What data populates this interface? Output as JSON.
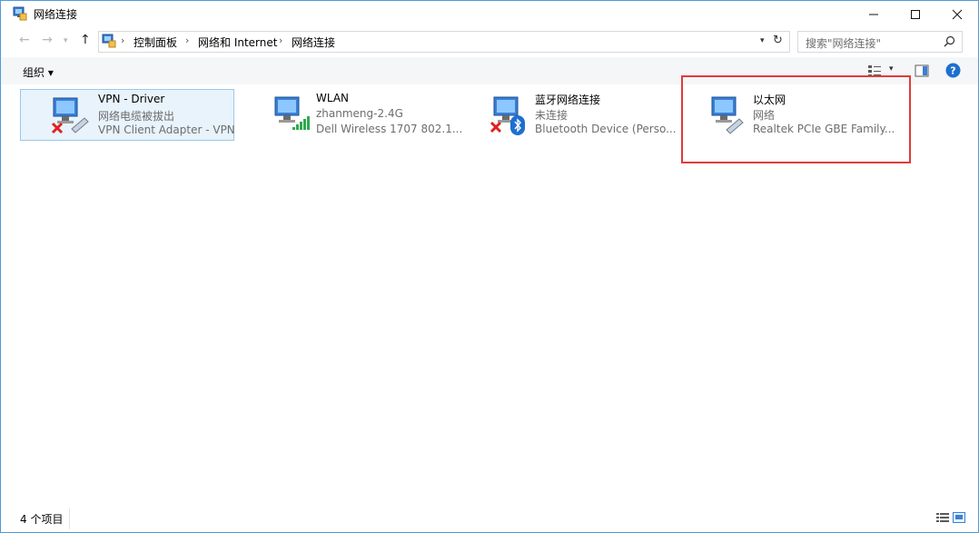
{
  "window": {
    "title": "网络连接",
    "controls": {
      "minimize": "—",
      "maximize": "☐",
      "close": "✕"
    }
  },
  "address_bar": {
    "crumbs": [
      "控制面板",
      "网络和 Internet",
      "网络连接"
    ],
    "separator": "›"
  },
  "search": {
    "placeholder": "搜索\"网络连接\""
  },
  "toolbar": {
    "organize_label": "组织 ▾"
  },
  "connections": [
    {
      "name": "VPN - Driver",
      "status": "网络电缆被拔出",
      "device": "VPN Client Adapter - VPN",
      "icon": "network-adapter-icon",
      "badge": "disconnected-x-icon",
      "selected": true
    },
    {
      "name": "WLAN",
      "status": "zhanmeng-2.4G",
      "device": "Dell Wireless 1707 802.1...",
      "icon": "network-adapter-icon",
      "badge": "wifi-signal-icon"
    },
    {
      "name": "蓝牙网络连接",
      "status": "未连接",
      "device": "Bluetooth Device (Perso...",
      "icon": "network-adapter-icon",
      "badge": "bluetooth-icon"
    },
    {
      "name": "以太网",
      "status": "网络",
      "device": "Realtek PCIe GBE Family...",
      "icon": "network-adapter-icon",
      "badge": "ethernet-cable-icon",
      "highlighted": true
    }
  ],
  "status_bar": {
    "item_count": "4 个项目"
  },
  "colors": {
    "accent": "#0078d7",
    "highlight_box": "#e03b3b",
    "selected_bg": "#e8f3fb"
  }
}
